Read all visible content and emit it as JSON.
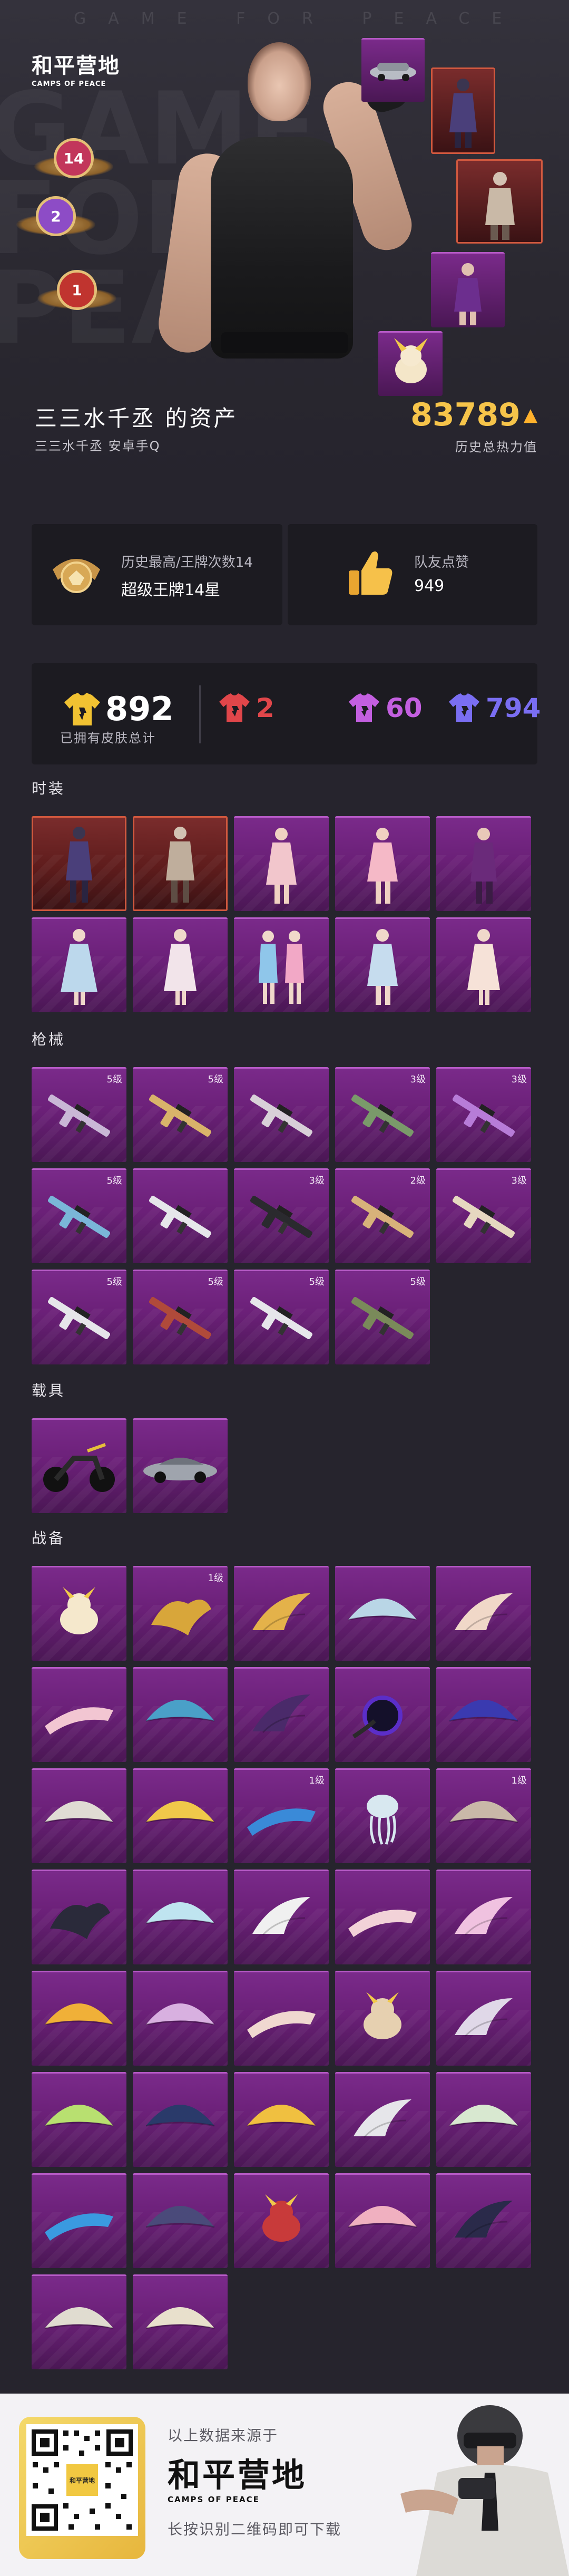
{
  "hero": {
    "watermark": "GAME FOR PEACE",
    "logo_cn": "和平营地",
    "logo_en": "CAMPS OF PEACE",
    "title": "三三水千丞 的资产",
    "subtitle": "三三水千丞  安卓手Q",
    "heat_value": "83789",
    "heat_label": "历史总热力值",
    "badges": [
      {
        "label": "14",
        "color": "#c2365b"
      },
      {
        "label": "2",
        "color": "#8d4cc6"
      },
      {
        "label": "1",
        "color": "#c0342f"
      }
    ]
  },
  "stats": {
    "best_label": "历史最高/王牌次数14",
    "best_value": "超级王牌14星",
    "likes_label": "队友点赞",
    "likes_value": "949"
  },
  "owned": {
    "total": "892",
    "total_label": "已拥有皮肤总计",
    "tiers": [
      {
        "count": "2",
        "color": "#e0464a"
      },
      {
        "count": "60",
        "color": "#c35fe0"
      },
      {
        "count": "794",
        "color": "#7a6ef2"
      }
    ]
  },
  "sections": {
    "outfits": "时装",
    "guns": "枪械",
    "vehicles": "载具",
    "gear": "战备"
  },
  "gun_levels": [
    "5级",
    "5级",
    "",
    "3级",
    "3级",
    "5级",
    "",
    "3级",
    "2级",
    "3级",
    "5级",
    "5级",
    "5级",
    "5级"
  ],
  "gear_levels": [
    "",
    "1级",
    "",
    "",
    "",
    "",
    "",
    "",
    "",
    "",
    "",
    "",
    "1级",
    "",
    "1级"
  ],
  "footer": {
    "source": "以上数据来源于",
    "logo_cn": "和平营地",
    "logo_en": "CAMPS OF PEACE",
    "hint": "长按识别二维码即可下载",
    "qr_label": "和平营地"
  }
}
